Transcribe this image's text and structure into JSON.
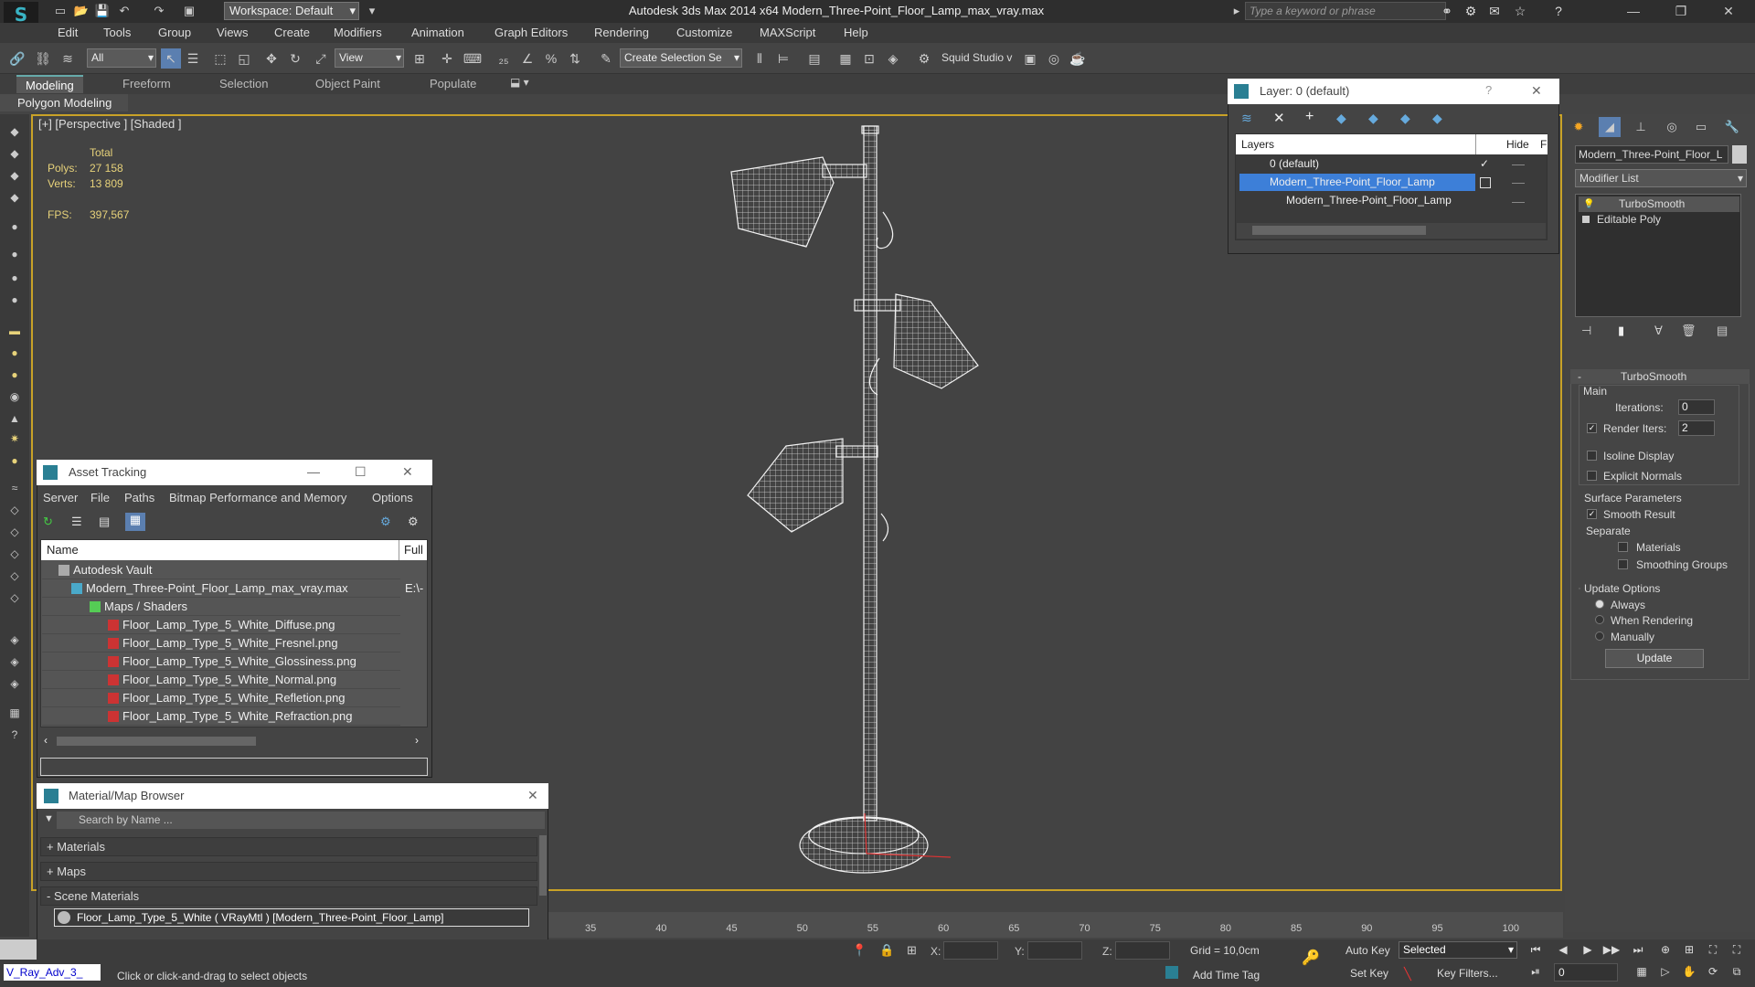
{
  "app": {
    "title": "Autodesk 3ds Max  2014 x64    Modern_Three-Point_Floor_Lamp_max_vray.max",
    "workspace": "Workspace: Default",
    "search_placeholder": "Type a keyword or phrase"
  },
  "menu": [
    "Edit",
    "Tools",
    "Group",
    "Views",
    "Create",
    "Modifiers",
    "Animation",
    "Graph Editors",
    "Rendering",
    "Customize",
    "MAXScript",
    "Help"
  ],
  "toolbar": {
    "filter": "All",
    "refcoord": "View",
    "selection_set": "Create Selection Se",
    "squid": "Squid Studio v"
  },
  "ribbon": {
    "tabs": [
      "Modeling",
      "Freeform",
      "Selection",
      "Object Paint",
      "Populate"
    ],
    "panel_label": "Polygon Modeling"
  },
  "viewport": {
    "label": "[+] [Perspective ] [Shaded ]",
    "stats": {
      "total": "Total",
      "polys_label": "Polys:",
      "polys": "27 158",
      "verts_label": "Verts:",
      "verts": "13 809",
      "fps_label": "FPS:",
      "fps": "397,567"
    }
  },
  "asset_tracking": {
    "title": "Asset Tracking",
    "menu": [
      "Server",
      "File",
      "Paths",
      "Bitmap Performance and Memory",
      "Options"
    ],
    "col_name": "Name",
    "col_full": "Full",
    "rows": [
      {
        "name": "Autodesk Vault",
        "full": ""
      },
      {
        "name": "Modern_Three-Point_Floor_Lamp_max_vray.max",
        "full": "E:\\-"
      },
      {
        "name": "Maps / Shaders",
        "full": ""
      },
      {
        "name": "Floor_Lamp_Type_5_White_Diffuse.png",
        "full": ""
      },
      {
        "name": "Floor_Lamp_Type_5_White_Fresnel.png",
        "full": ""
      },
      {
        "name": "Floor_Lamp_Type_5_White_Glossiness.png",
        "full": ""
      },
      {
        "name": "Floor_Lamp_Type_5_White_Normal.png",
        "full": ""
      },
      {
        "name": "Floor_Lamp_Type_5_White_Refletion.png",
        "full": ""
      },
      {
        "name": "Floor_Lamp_Type_5_White_Refraction.png",
        "full": ""
      }
    ]
  },
  "material_browser": {
    "title": "Material/Map Browser",
    "search_placeholder": "Search by Name ...",
    "sections": [
      "+ Materials",
      "+ Maps",
      "- Scene Materials"
    ],
    "item": "Floor_Lamp_Type_5_White  ( VRayMtl ) [Modern_Three-Point_Floor_Lamp]"
  },
  "layer_panel": {
    "title": "Layer: 0 (default)",
    "col_layers": "Layers",
    "col_hide": "Hide",
    "col_f": "F",
    "rows": [
      "0 (default)",
      "Modern_Three-Point_Floor_Lamp",
      "Modern_Three-Point_Floor_Lamp"
    ]
  },
  "command_panel": {
    "object_name": "Modern_Three-Point_Floor_L",
    "modifier_list": "Modifier List",
    "stack": [
      "TurboSmooth",
      "Editable Poly"
    ],
    "rollout_title": "TurboSmooth",
    "main": "Main",
    "iterations_label": "Iterations:",
    "iterations": "0",
    "render_iters_label": "Render Iters:",
    "render_iters": "2",
    "isoline": "Isoline Display",
    "explicit_normals": "Explicit Normals",
    "surface_params": "Surface Parameters",
    "smooth_result": "Smooth Result",
    "separate": "Separate",
    "materials": "Materials",
    "smoothing_groups": "Smoothing Groups",
    "update_options": "Update Options",
    "always": "Always",
    "when_rendering": "When Rendering",
    "manually": "Manually",
    "update_btn": "Update"
  },
  "timeline": {
    "ticks": [
      "35",
      "40",
      "45",
      "50",
      "55",
      "60",
      "65",
      "70",
      "75",
      "80",
      "85",
      "90",
      "95",
      "100"
    ]
  },
  "status": {
    "maxscript": "V_Ray_Adv_3_",
    "prompt": "Click or click-and-drag to select objects",
    "x_label": "X:",
    "y_label": "Y:",
    "z_label": "Z:",
    "grid": "Grid = 10,0cm",
    "add_time_tag": "Add Time Tag",
    "auto_key": "Auto Key",
    "set_key": "Set Key",
    "selected": "Selected",
    "key_filters": "Key Filters...",
    "frame": "0"
  }
}
